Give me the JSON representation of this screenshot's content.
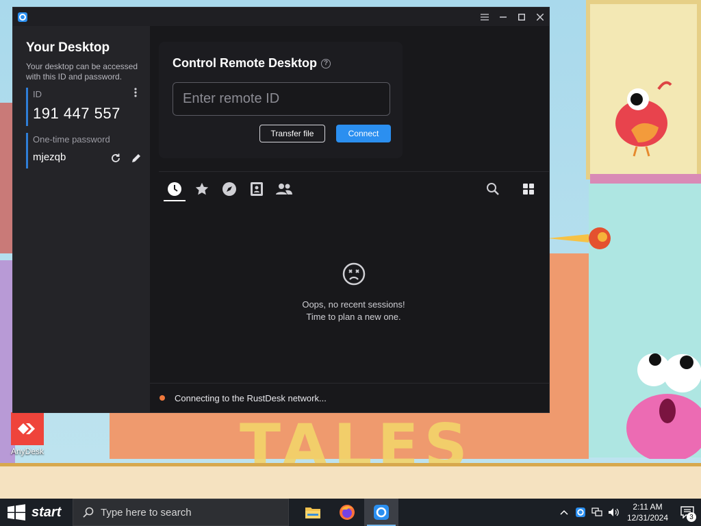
{
  "desktop": {
    "wallpaper_letters": "TALES",
    "icons": [
      {
        "label": "AnyDesk",
        "icon": "anydesk-icon"
      }
    ]
  },
  "window": {
    "app_icon": "rustdesk-logo",
    "controls": [
      "menu-icon",
      "minimize-icon",
      "maximize-icon",
      "close-icon"
    ]
  },
  "sidebar": {
    "title": "Your Desktop",
    "description": "Your desktop can be accessed with this ID and password.",
    "id_label": "ID",
    "id_value": "191 447 557",
    "password_label": "One-time password",
    "password_value": "mjezqb"
  },
  "control": {
    "title": "Control Remote Desktop",
    "input_placeholder": "Enter remote ID",
    "input_value": "",
    "transfer_label": "Transfer file",
    "connect_label": "Connect"
  },
  "tabs": [
    {
      "icon": "clock-icon",
      "name": "recent",
      "active": true
    },
    {
      "icon": "star-icon",
      "name": "favorites",
      "active": false
    },
    {
      "icon": "compass-icon",
      "name": "discovered",
      "active": false
    },
    {
      "icon": "address-book-icon",
      "name": "address-book",
      "active": false
    },
    {
      "icon": "people-icon",
      "name": "group",
      "active": false
    }
  ],
  "empty_state": {
    "line1": "Oops, no recent sessions!",
    "line2": "Time to plan a new one."
  },
  "status": {
    "text": "Connecting to the RustDesk network...",
    "dot_color": "#f0793c"
  },
  "taskbar": {
    "start_label": "start",
    "search_placeholder": "Type here to search",
    "pinned": [
      "file-explorer-icon",
      "firefox-icon",
      "rustdesk-icon"
    ],
    "time": "2:11 AM",
    "date": "12/31/2024",
    "notification_count": "3"
  },
  "colors": {
    "accent": "#2b8ff0",
    "window_bg": "#18181b",
    "sidebar_bg": "#242428"
  }
}
